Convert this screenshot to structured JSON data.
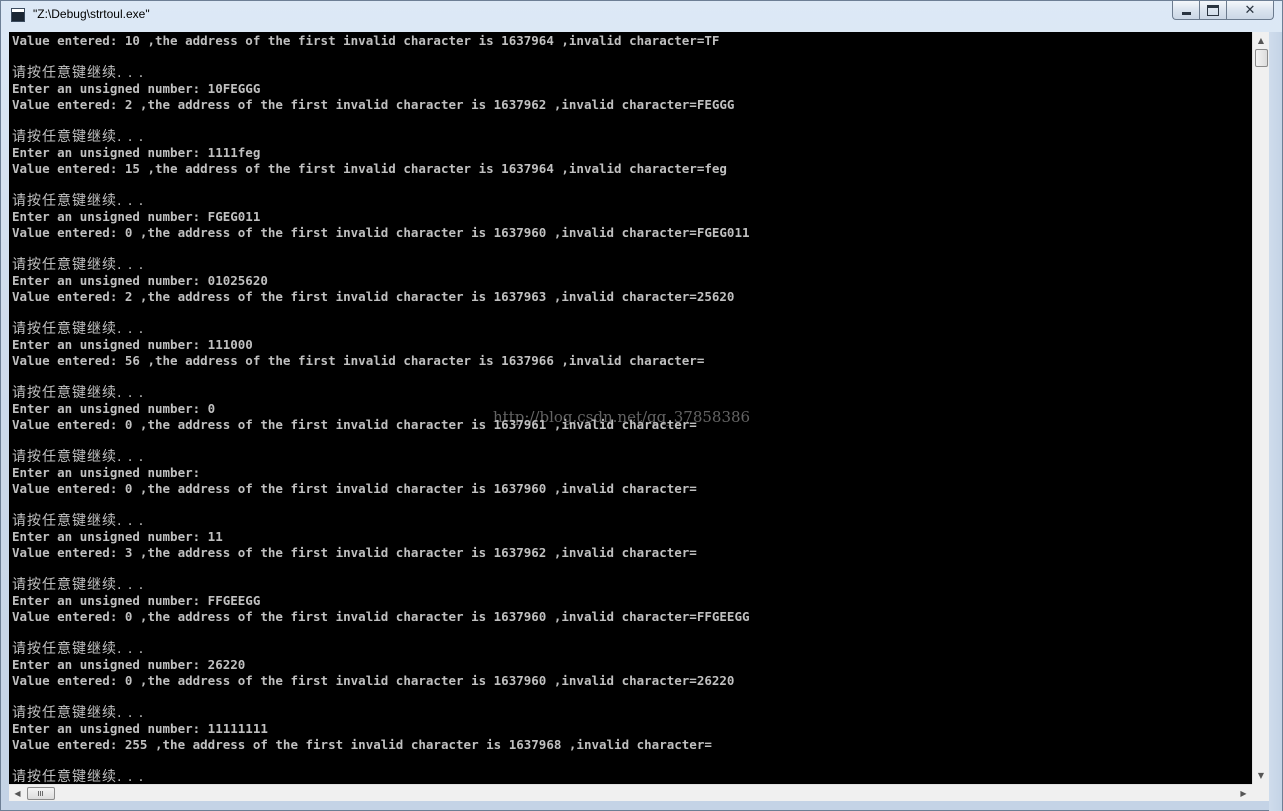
{
  "window": {
    "title": "\"Z:\\Debug\\strtoul.exe\"",
    "caption_buttons": {
      "minimize": "minimize",
      "maximize": "maximize",
      "close": "✕"
    }
  },
  "console": {
    "lines": [
      {
        "kind": "en",
        "text": "Value entered: 10 ,the address of the first invalid character is 1637964 ,invalid character=TF"
      },
      {
        "kind": "en",
        "text": ""
      },
      {
        "kind": "cn",
        "text": "请按任意键继续. . ."
      },
      {
        "kind": "en",
        "text": "Enter an unsigned number: 10FEGGG"
      },
      {
        "kind": "en",
        "text": "Value entered: 2 ,the address of the first invalid character is 1637962 ,invalid character=FEGGG"
      },
      {
        "kind": "en",
        "text": ""
      },
      {
        "kind": "cn",
        "text": "请按任意键继续. . ."
      },
      {
        "kind": "en",
        "text": "Enter an unsigned number: 1111feg"
      },
      {
        "kind": "en",
        "text": "Value entered: 15 ,the address of the first invalid character is 1637964 ,invalid character=feg"
      },
      {
        "kind": "en",
        "text": ""
      },
      {
        "kind": "cn",
        "text": "请按任意键继续. . ."
      },
      {
        "kind": "en",
        "text": "Enter an unsigned number: FGEG011"
      },
      {
        "kind": "en",
        "text": "Value entered: 0 ,the address of the first invalid character is 1637960 ,invalid character=FGEG011"
      },
      {
        "kind": "en",
        "text": ""
      },
      {
        "kind": "cn",
        "text": "请按任意键继续. . ."
      },
      {
        "kind": "en",
        "text": "Enter an unsigned number: 01025620"
      },
      {
        "kind": "en",
        "text": "Value entered: 2 ,the address of the first invalid character is 1637963 ,invalid character=25620"
      },
      {
        "kind": "en",
        "text": ""
      },
      {
        "kind": "cn",
        "text": "请按任意键继续. . ."
      },
      {
        "kind": "en",
        "text": "Enter an unsigned number: 111000"
      },
      {
        "kind": "en",
        "text": "Value entered: 56 ,the address of the first invalid character is 1637966 ,invalid character="
      },
      {
        "kind": "en",
        "text": ""
      },
      {
        "kind": "cn",
        "text": "请按任意键继续. . ."
      },
      {
        "kind": "en",
        "text": "Enter an unsigned number: 0"
      },
      {
        "kind": "en",
        "text": "Value entered: 0 ,the address of the first invalid character is 1637961 ,invalid character="
      },
      {
        "kind": "en",
        "text": ""
      },
      {
        "kind": "cn",
        "text": "请按任意键继续. . ."
      },
      {
        "kind": "en",
        "text": "Enter an unsigned number:"
      },
      {
        "kind": "en",
        "text": "Value entered: 0 ,the address of the first invalid character is 1637960 ,invalid character="
      },
      {
        "kind": "en",
        "text": ""
      },
      {
        "kind": "cn",
        "text": "请按任意键继续. . ."
      },
      {
        "kind": "en",
        "text": "Enter an unsigned number: 11"
      },
      {
        "kind": "en",
        "text": "Value entered: 3 ,the address of the first invalid character is 1637962 ,invalid character="
      },
      {
        "kind": "en",
        "text": ""
      },
      {
        "kind": "cn",
        "text": "请按任意键继续. . ."
      },
      {
        "kind": "en",
        "text": "Enter an unsigned number: FFGEEGG"
      },
      {
        "kind": "en",
        "text": "Value entered: 0 ,the address of the first invalid character is 1637960 ,invalid character=FFGEEGG"
      },
      {
        "kind": "en",
        "text": ""
      },
      {
        "kind": "cn",
        "text": "请按任意键继续. . ."
      },
      {
        "kind": "en",
        "text": "Enter an unsigned number: 26220"
      },
      {
        "kind": "en",
        "text": "Value entered: 0 ,the address of the first invalid character is 1637960 ,invalid character=26220"
      },
      {
        "kind": "en",
        "text": ""
      },
      {
        "kind": "cn",
        "text": "请按任意键继续. . ."
      },
      {
        "kind": "en",
        "text": "Enter an unsigned number: 11111111"
      },
      {
        "kind": "en",
        "text": "Value entered: 255 ,the address of the first invalid character is 1637968 ,invalid character="
      },
      {
        "kind": "en",
        "text": ""
      },
      {
        "kind": "cn",
        "text": "请按任意键继续. . ."
      }
    ],
    "watermark": "http://blog.csdn.net/qq_37858386"
  },
  "scrollbars": {
    "up_arrow": "▲",
    "down_arrow": "▼",
    "left_arrow": "◀",
    "right_arrow": "▶"
  },
  "colors": {
    "console_background": "#000000",
    "console_text": "#c0c0c0",
    "window_frame": "#cfdcec"
  }
}
